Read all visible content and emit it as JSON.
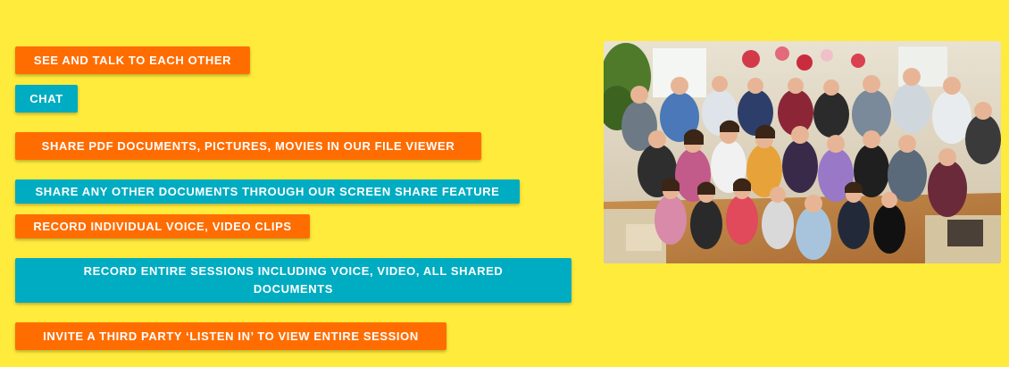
{
  "features": {
    "see_talk": "SEE AND TALK TO EACH OTHER",
    "chat": "CHAT",
    "share_pdf": "SHARE PDF DOCUMENTS, PICTURES, MOVIES IN OUR FILE VIEWER",
    "share_other": "SHARE ANY OTHER DOCUMENTS THROUGH OUR SCREEN SHARE FEATURE",
    "record_individual": "RECORD INDIVIDUAL VOICE, VIDEO CLIPS",
    "record_entire": "RECORD ENTIRE SESSIONS INCLUDING VOICE, VIDEO, ALL SHARED DOCUMENTS",
    "invite": "INVITE A THIRD PARTY ‘LISTEN IN’ TO VIEW ENTIRE SESSION"
  },
  "colors": {
    "background": "#ffeb3b",
    "orange": "#ff6d00",
    "teal": "#00acc1"
  }
}
